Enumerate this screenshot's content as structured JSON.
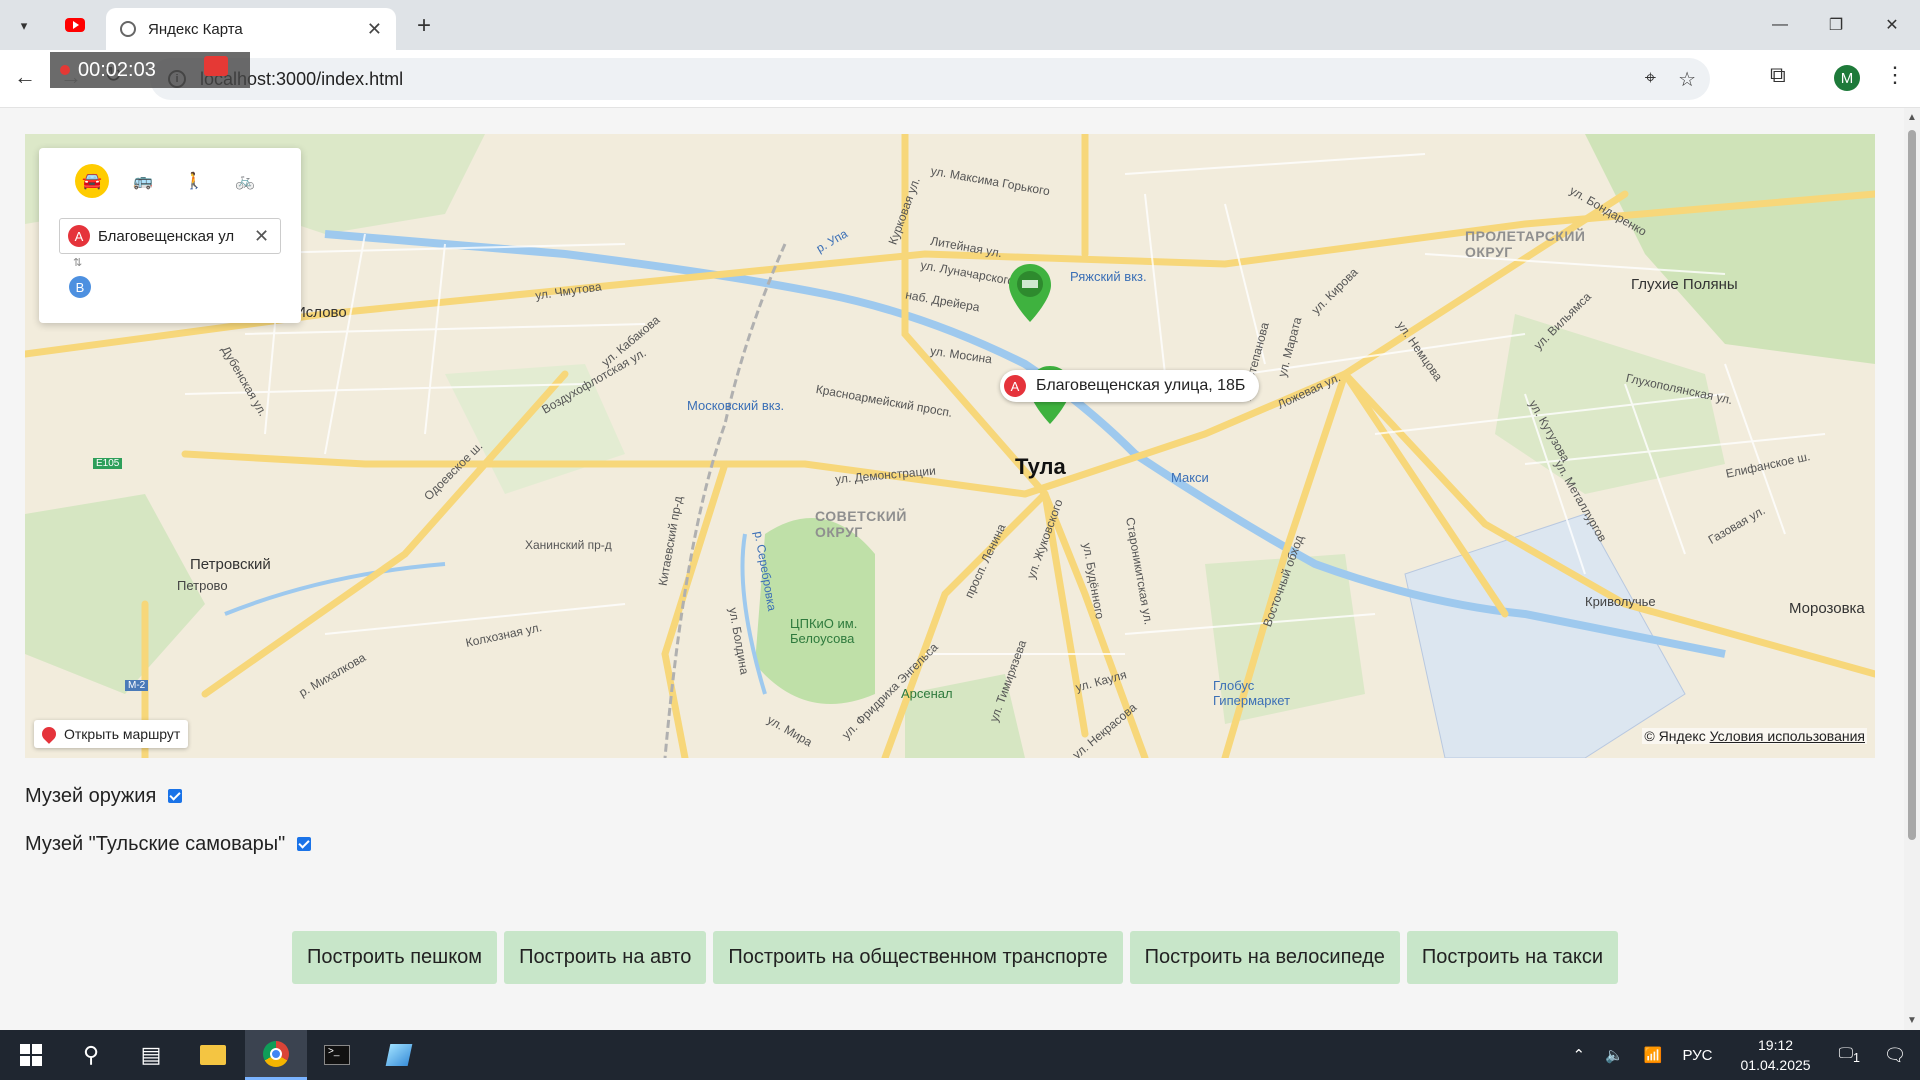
{
  "browser": {
    "tab_title": "Яндекс Карта",
    "url": "localhost:3000/index.html",
    "profile_initial": "M",
    "recording_time": "00:02:03"
  },
  "map": {
    "route_panel": {
      "modes": [
        "car-icon",
        "bus-icon",
        "walk-icon",
        "bike-icon"
      ],
      "active_mode": "car-icon",
      "point_a_label": "A",
      "point_a_value": "Благовещенская ул",
      "point_b_label": "B"
    },
    "address_label": "Благовещенская улица, 18Б",
    "open_route_label": "Открыть маршрут",
    "copyright": "© Яндекс",
    "terms_link": "Условия использования",
    "city_name": "Тула",
    "places": {
      "proletarsky": "ПРОЛЕТАРСКИЙ\nОКРУГ",
      "sovetsky": "СОВЕТСКИЙ\nОКРУГ",
      "glukhie_polyany": "Глухие Поляны",
      "morozovka": "Морозовка",
      "krivoluchye": "Криволучье",
      "petrovsky": "Петровский",
      "petrovo": "Петрово",
      "slovo": "Ислово",
      "ryazhsky": "Ряжский вкз.",
      "moskovsky": "Московский вкз.",
      "maksi": "Макси",
      "park": "ЦПКиО им.\nБелоусова",
      "arsenal": "Арсенал",
      "globus": "Глобус\nГипермаркет",
      "e105": "E105",
      "m2": "M-2"
    },
    "streets": {
      "maksima_gorkogo": "ул. Максима Горького",
      "kurkova": "Курковая ул.",
      "liteynaya": "Литейная ул.",
      "lunacharskogo": "ул. Луначарского",
      "dreyera": "наб. Дрейера",
      "chmutova": "ул. Чмутова",
      "kabakova": "ул. Кабакова",
      "vozdukhoflotskaya": "Воздухофлотская ул.",
      "mosina": "ул. Мосина",
      "krasnoarmeysky": "Красноармейский просп.",
      "demonstratsii": "ул. Демонстрации",
      "odoevskoe": "Одоевское ш.",
      "khaninsky": "Ханинский пр-д",
      "kitaevsky": "Китаевский пр-д",
      "lenina": "просп. Ленина",
      "zhukovskogo": "ул. Жуковского",
      "budennogo": "ул. Будённого",
      "staronikitskaya": "Староникитская ул.",
      "vostochny": "Восточный обход",
      "lozhevaya": "Ложевая ул.",
      "kirova": "ул. Кирова",
      "kutuzova": "ул. Кутузова",
      "metallurgov": "ул. Металлургов",
      "vilyamsa": "ул. Вильямса",
      "bondarenko": "ул. Бондаренко",
      "boldina": "ул. Болдина",
      "fr_engelsa": "ул. Фридриха Энгельса",
      "timiryazeva": "ул. Тимирязева",
      "kaulya": "ул. Кауля",
      "nekrasova": "ул. Некрасова",
      "kolkhoznaya": "Колхозная ул.",
      "mikhalkova": "р. Михалкова",
      "mira": "ул. Мира",
      "upa": "р. Упа",
      "serebrovka": "р. Серебровка",
      "dubenskaya": "Дубенская ул.",
      "elifanskoe": "Елифанское ш.",
      "gazovaya": "Газовая ул.",
      "glukhopolyanskaya": "Глухополянская ул.",
      "nemtsova": "ул. Немцова",
      "stepanova": "ул. Степанова",
      "marata": "ул. Марата",
      "kirovskaya": "ул. Кирова"
    }
  },
  "museums": [
    {
      "label": "Музей оружия",
      "checked": true
    },
    {
      "label": "Музей \"Тульские самовары\"",
      "checked": true
    }
  ],
  "buttons": [
    "Построить пешком",
    "Построить на авто",
    "Построить на общественном транспорте",
    "Построить на велосипеде",
    "Построить на такси"
  ],
  "taskbar": {
    "language": "РУС",
    "time": "19:12",
    "date": "01.04.2025",
    "notification_count": "1"
  },
  "colors": {
    "route_a": "#e5333b",
    "route_b": "#4d90e0",
    "active_mode": "#ffcc00",
    "button_bg": "#c8e6c9",
    "museum_pin": "#3fb23f"
  }
}
